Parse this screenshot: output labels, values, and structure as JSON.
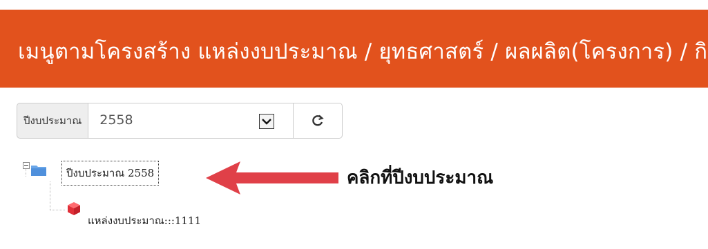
{
  "header": {
    "title": "เมนูตามโครงสร้าง แหล่งงบประมาณ / ยุทธศาสตร์ / ผลผลิต(โครงการ) / กิจกรรม",
    "background_color": "#e2521d"
  },
  "fiscal_year": {
    "label": "ปีงบประมาณ",
    "selected_value": "2558",
    "dropdown_icon": "chevron-down-icon",
    "refresh_icon": "refresh-icon"
  },
  "tree": {
    "root": {
      "label": "ปีงบประมาณ 2558",
      "icon": "folder-icon",
      "toggle_icon": "collapse-toggle-icon",
      "children": [
        {
          "label": "แหล่งงบประมาณ:::1111",
          "icon": "cube-icon"
        }
      ]
    }
  },
  "annotation": {
    "text": "คลิกที่ปีงบประมาณ",
    "arrow_color": "#e04048"
  }
}
